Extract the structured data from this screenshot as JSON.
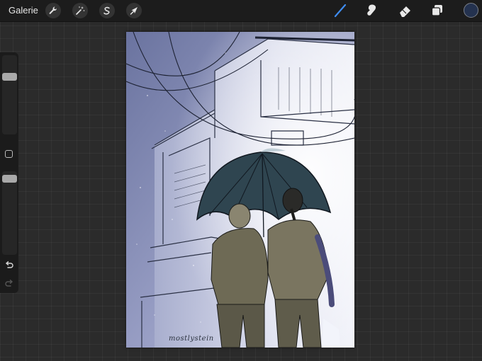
{
  "topbar": {
    "gallery_label": "Galerie",
    "left_tools": [
      {
        "name": "wrench-icon",
        "label": "Actions"
      },
      {
        "name": "magic-wand-icon",
        "label": "Adjustments"
      },
      {
        "name": "selection-icon",
        "label": "Selection"
      },
      {
        "name": "arrow-cursor-icon",
        "label": "Transform"
      }
    ],
    "right_tools": [
      {
        "name": "brush-icon",
        "active": true
      },
      {
        "name": "smudge-icon",
        "active": false
      },
      {
        "name": "eraser-icon",
        "active": false
      },
      {
        "name": "layers-icon",
        "active": false
      }
    ],
    "current_color": "#24324f",
    "active_tool_color": "#3f8cf0"
  },
  "sidebar": {
    "brush_size_level": 0.75,
    "opacity_level": 0.05
  },
  "canvas": {
    "signature": "mostlystein"
  }
}
